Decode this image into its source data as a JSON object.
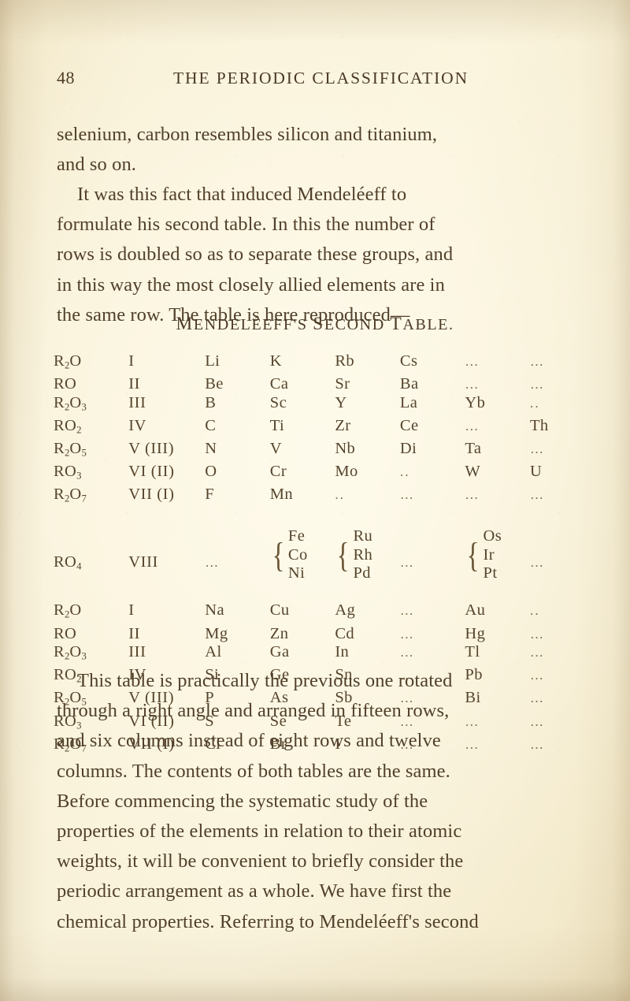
{
  "page": {
    "folio": "48",
    "running_head": "THE PERIODIC CLASSIFICATION",
    "paper_color": "#f6eed4",
    "ink_color": "#51402a"
  },
  "paragraph_1": {
    "lines": [
      "selenium, carbon resembles silicon and titanium,",
      "and so on."
    ]
  },
  "paragraph_2": {
    "lines": [
      "It was this fact that induced Mendeléeff to",
      "formulate his second table.  In this the number of",
      "rows is doubled so as to separate these groups, and",
      "in this way the most closely allied elements are in",
      "the same row.  The table is here reproduced—"
    ]
  },
  "table_caption": "Mendeléeff's Second Table.",
  "periodic_table": {
    "column_count": 8,
    "rows": [
      {
        "oxide": "R2O",
        "group": "I",
        "elements": [
          "Li",
          "K",
          "Rb",
          "Cs",
          "…",
          "…"
        ]
      },
      {
        "oxide": "RO",
        "group": "II",
        "elements": [
          "Be",
          "Ca",
          "Sr",
          "Ba",
          "…",
          "…"
        ]
      },
      {
        "oxide": "R2O3",
        "group": "III",
        "elements": [
          "B",
          "Sc",
          "Y",
          "La",
          "Yb",
          ".."
        ]
      },
      {
        "oxide": "RO2",
        "group": "IV",
        "elements": [
          "C",
          "Ti",
          "Zr",
          "Ce",
          "…",
          "Th"
        ]
      },
      {
        "oxide": "R2O5",
        "group": "V (III)",
        "elements": [
          "N",
          "V",
          "Nb",
          "Di",
          "Ta",
          "…"
        ]
      },
      {
        "oxide": "RO3",
        "group": "VI (II)",
        "elements": [
          "O",
          "Cr",
          "Mo",
          "..",
          "W",
          "U"
        ]
      },
      {
        "oxide": "R2O7",
        "group": "VII (I)",
        "elements": [
          "F",
          "Mn",
          "..",
          "…",
          "…",
          "…"
        ]
      }
    ],
    "triad_row": {
      "oxide": "RO4",
      "group": "VIII",
      "cells": [
        {
          "type": "dots",
          "value": "…"
        },
        {
          "type": "triad",
          "value": [
            "Fe",
            "Co",
            "Ni"
          ]
        },
        {
          "type": "triad",
          "value": [
            "Ru",
            "Rh",
            "Pd"
          ]
        },
        {
          "type": "dots",
          "value": "…"
        },
        {
          "type": "triad",
          "value": [
            "Os",
            "Ir",
            "Pt"
          ]
        },
        {
          "type": "dots",
          "value": "…"
        }
      ]
    },
    "rows_lower": [
      {
        "oxide": "R2O",
        "group": "I",
        "elements": [
          "Na",
          "Cu",
          "Ag",
          "…",
          "Au",
          ".."
        ]
      },
      {
        "oxide": "RO",
        "group": "II",
        "elements": [
          "Mg",
          "Zn",
          "Cd",
          "…",
          "Hg",
          "…"
        ]
      },
      {
        "oxide": "R2O3",
        "group": "III",
        "elements": [
          "Al",
          "Ga",
          "In",
          "…",
          "Tl",
          "…"
        ]
      },
      {
        "oxide": "RO2",
        "group": "IV",
        "elements": [
          "Si",
          "Ge",
          "Sn",
          "…",
          "Pb",
          "…"
        ]
      },
      {
        "oxide": "R2O5",
        "group": "V (III)",
        "elements": [
          "P",
          "As",
          "Sb",
          "…",
          "Bi",
          "…"
        ]
      },
      {
        "oxide": "RO3",
        "group": "VI (II)",
        "elements": [
          "S",
          "Se",
          "Te",
          "…",
          "…",
          "…"
        ]
      },
      {
        "oxide": "R2O7",
        "group": "VII (I)",
        "elements": [
          "Cl",
          "Br",
          "I",
          "…",
          "…",
          "…"
        ]
      }
    ]
  },
  "paragraph_3": {
    "lines": [
      "This table is practically the previous one rotated",
      "through a right angle and arranged in fifteen rows,",
      "and six columns instead of eight rows and twelve",
      "columns.  The contents of both tables are the same.",
      "Before commencing the systematic study of the",
      "properties of the elements in relation to their atomic",
      "weights, it will be convenient to briefly consider the",
      "periodic arrangement as a whole.  We have first the",
      "chemical properties.  Referring to Mendeléeff's second"
    ]
  }
}
